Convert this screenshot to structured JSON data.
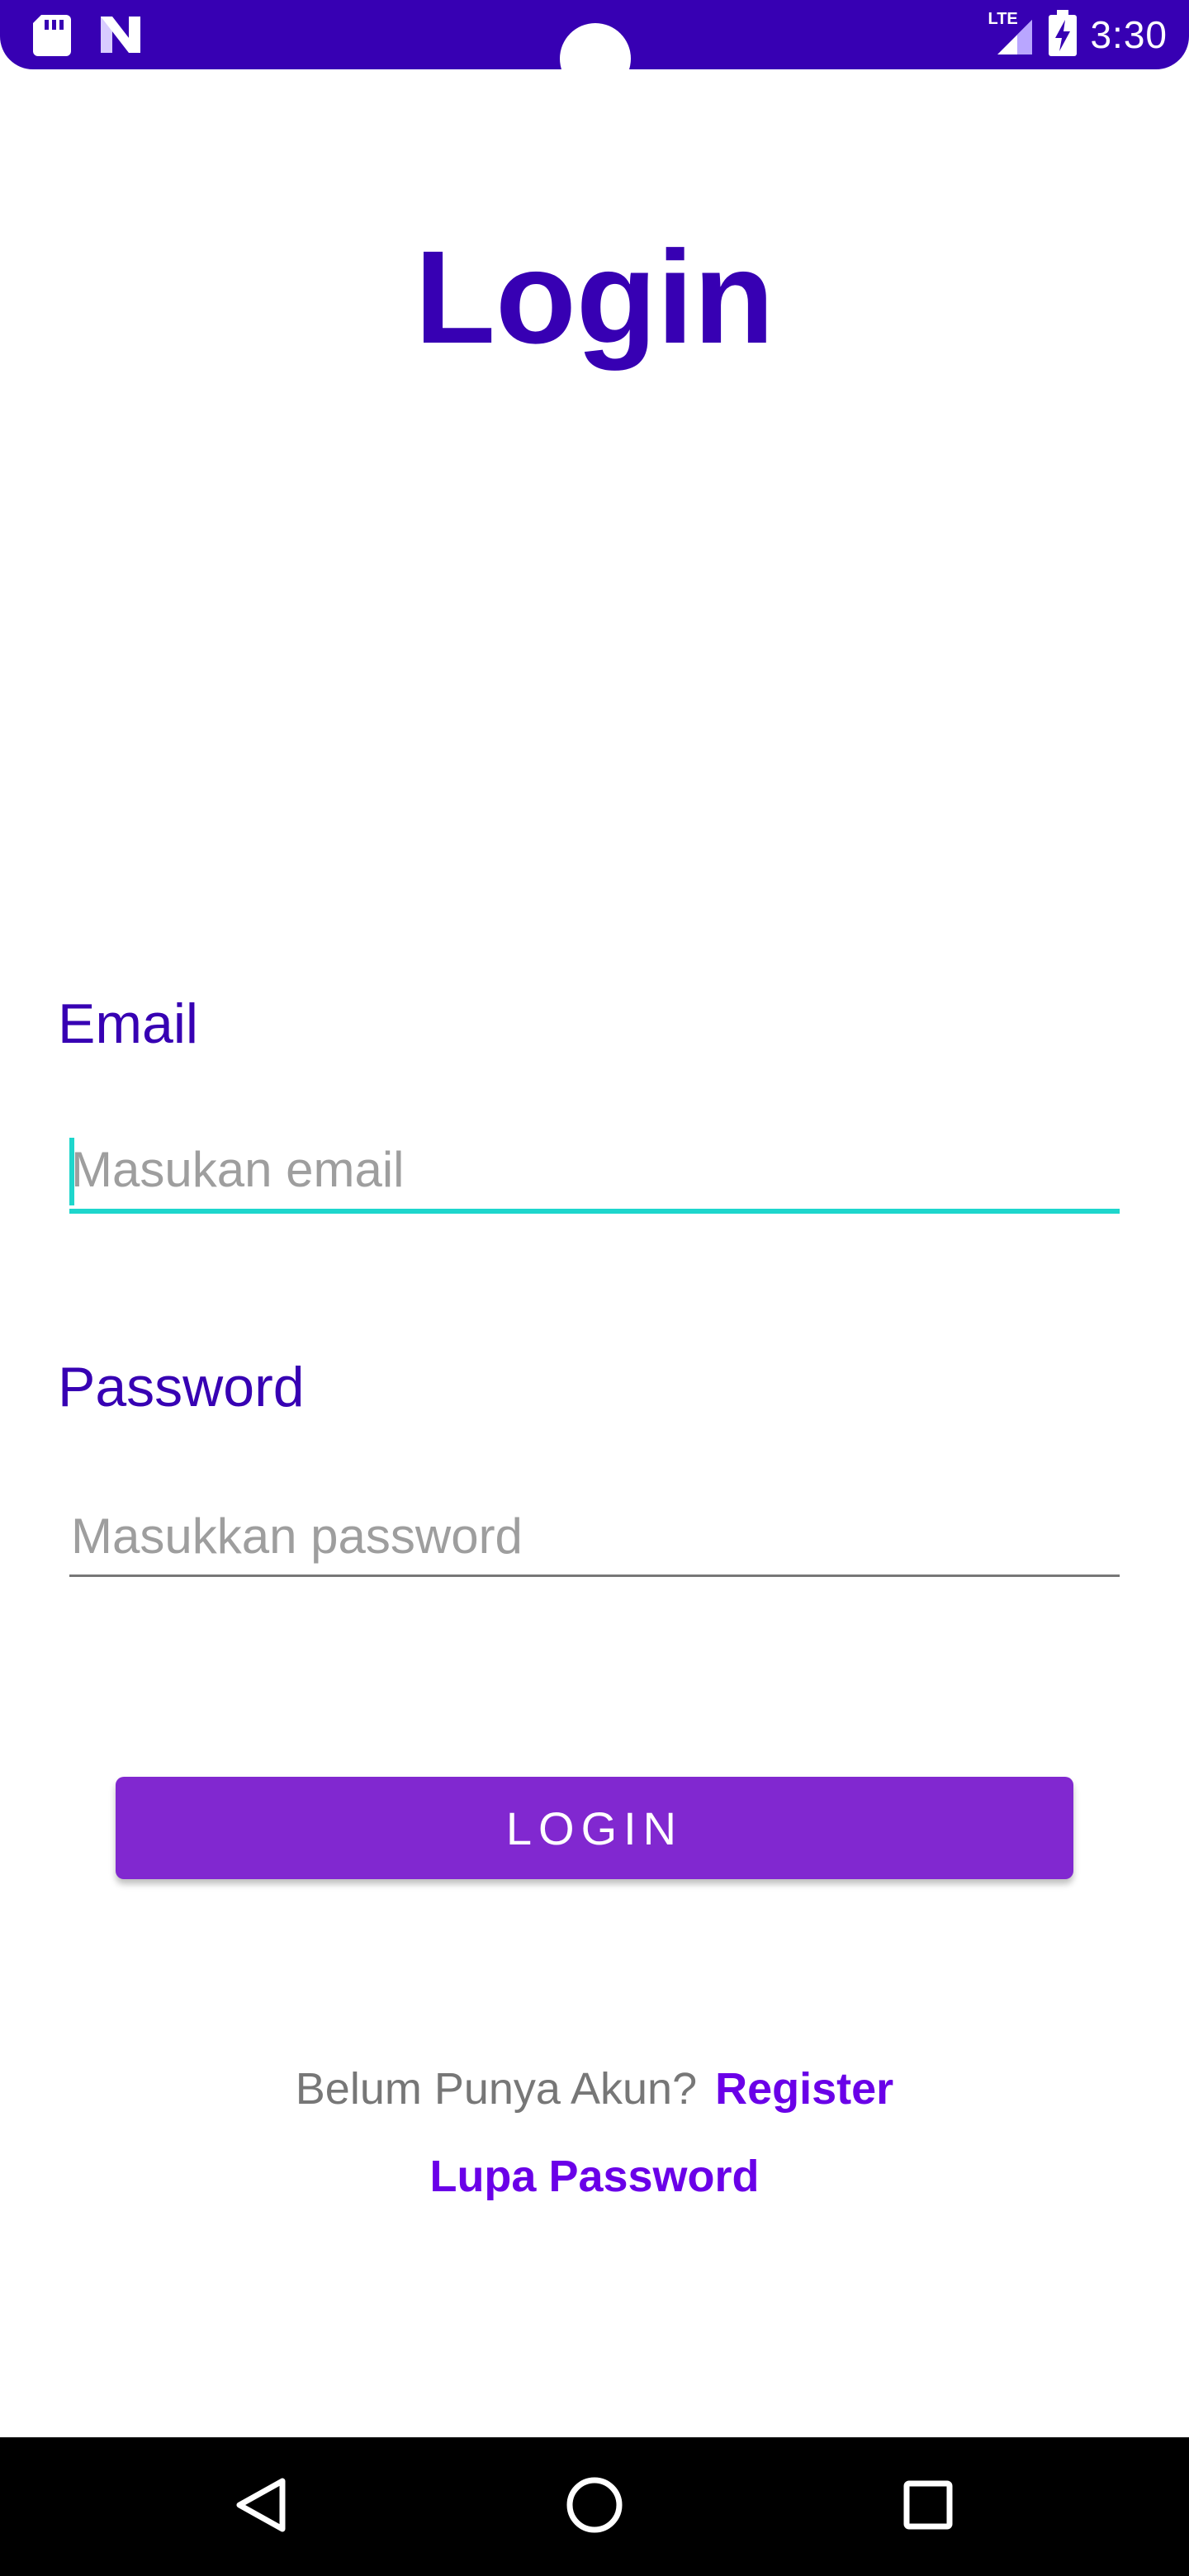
{
  "status_bar": {
    "time": "3:30",
    "network_label": "LTE",
    "background": "#3700B3",
    "icons": [
      "sd-card-icon",
      "n-logo-icon",
      "lte-signal-icon",
      "battery-charging-icon"
    ]
  },
  "title": "Login",
  "email": {
    "label": "Email",
    "placeholder": "Masukan email",
    "value": ""
  },
  "password": {
    "label": "Password",
    "placeholder": "Masukkan password",
    "value": ""
  },
  "login_button": {
    "label": "LOGIN"
  },
  "register": {
    "question": "Belum Punya Akun?",
    "link": "Register"
  },
  "forgot_password": "Lupa Password",
  "navigation": {
    "icons": [
      "back-icon",
      "home-icon",
      "recents-icon"
    ]
  },
  "colors": {
    "primary_dark": "#3700B3",
    "button": "#8128D0",
    "link": "#6a00e8",
    "focus_accent": "#1ed6cc"
  }
}
